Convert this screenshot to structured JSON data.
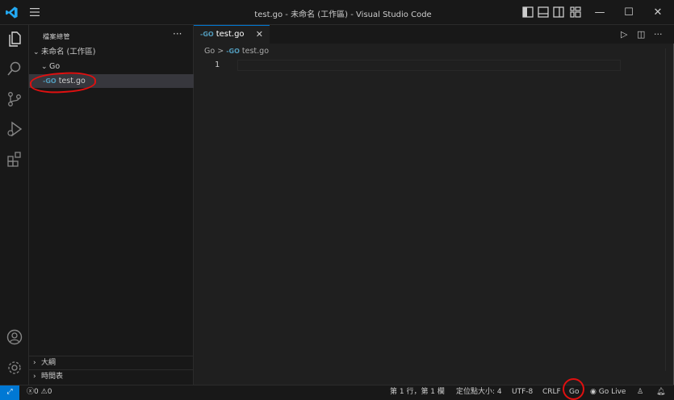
{
  "window": {
    "title": "test.go - 未命名 (工作區) - Visual Studio Code",
    "controls": {
      "minimize": "—",
      "maximize": "☐",
      "close": "✕"
    }
  },
  "sidebar": {
    "header": "檔案總管",
    "more": "···",
    "workspace": "未命名 (工作區)",
    "folder": "Go",
    "file_badge": "-GO",
    "file": "test.go",
    "sections": [
      "大綱",
      "時間表"
    ]
  },
  "editor": {
    "tab_label": "test.go",
    "tab_close": "✕",
    "breadcrumb_folder": "Go",
    "breadcrumb_sep": ">",
    "breadcrumb_file": "test.go",
    "line_number": "1",
    "run": "▷",
    "split": "◫",
    "more": "···"
  },
  "statusbar": {
    "remote": "⤢",
    "errors": "0",
    "warnings": "0",
    "position": "第 1 行，第 1 欄",
    "indent": "定位點大小: 4",
    "encoding": "UTF-8",
    "eol": "CRLF",
    "language": "Go",
    "golive": "Go Live"
  },
  "colors": {
    "accent": "#0078d4",
    "annotation": "#e01010",
    "go": "#519aba"
  }
}
